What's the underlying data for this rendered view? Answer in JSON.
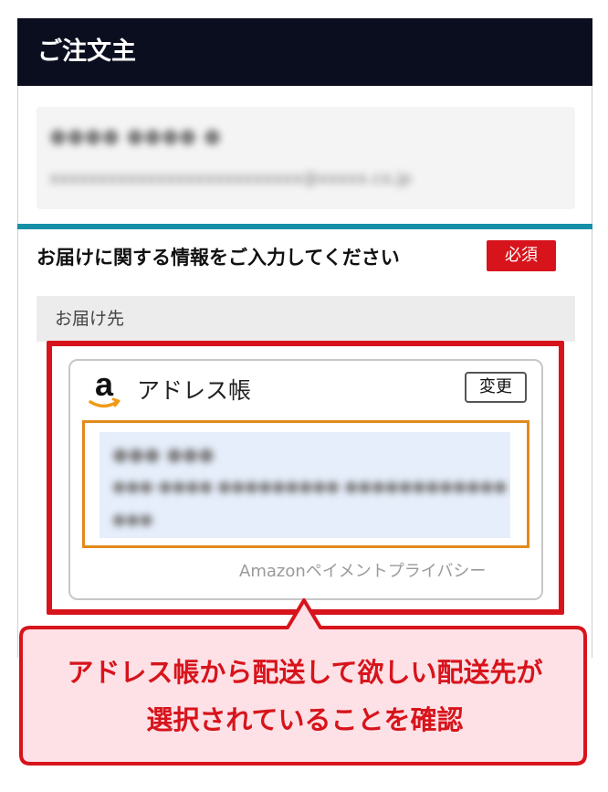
{
  "header": {
    "title": "ご注文主"
  },
  "buyer": {
    "name": "●●●● ●●●● ●",
    "email": "xxxxxxxxxxxxxxxxxxxxxxxxxx@xxxxx.co.jp"
  },
  "delivery": {
    "section_title": "お届けに関する情報をご入力してください",
    "required_label": "必須",
    "shipto_label": "お届け先"
  },
  "address_book": {
    "logo_icon": "amazon-a-logo-icon",
    "title": "アドレス帳",
    "change_label": "変更",
    "selected": {
      "name": "●●● ●●●",
      "line1": "●●●-●●●● ●●●●●●●●● ●●●●●●●●●●●●",
      "line2": "●●●"
    },
    "privacy_link": "Amazonペイメントプライバシー"
  },
  "annotation": {
    "line1": "アドレス帳から配送して欲しい配送先が",
    "line2": "選択されていることを確認"
  },
  "colors": {
    "header_bg": "#0b0e1f",
    "accent_teal": "#158fa6",
    "required_red": "#d7141c",
    "selected_orange": "#e28a1c",
    "callout_fill": "#fde1e6"
  }
}
